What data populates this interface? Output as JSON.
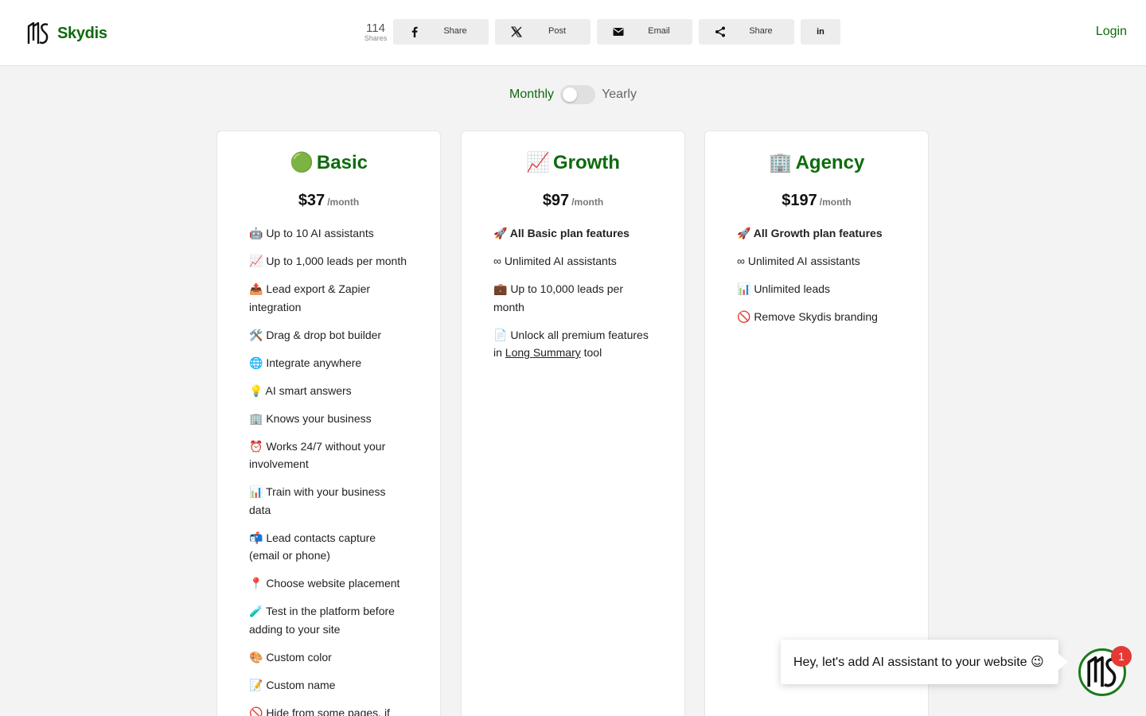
{
  "header": {
    "brand": "Skydis",
    "share_count": "114",
    "share_count_label": "Shares",
    "share_buttons": [
      {
        "label": "Share",
        "icon": "facebook-icon"
      },
      {
        "label": "Post",
        "icon": "x-icon"
      },
      {
        "label": "Email",
        "icon": "email-icon"
      },
      {
        "label": "Share",
        "icon": "share-icon"
      },
      {
        "label": "",
        "icon": "linkedin-icon"
      }
    ],
    "linkedin_glyph": "in",
    "login_label": "Login"
  },
  "billing_toggle": {
    "monthly_label": "Monthly",
    "yearly_label": "Yearly",
    "selected": "Monthly"
  },
  "plans": [
    {
      "emoji": "🟢",
      "name": "Basic",
      "price": "$37",
      "period": "/month",
      "features": [
        "🤖 Up to 10 AI assistants",
        "📈 Up to 1,000 leads per month",
        "📤 Lead export & Zapier integration",
        "🛠️ Drag & drop bot builder",
        "🌐 Integrate anywhere",
        "💡 AI smart answers",
        "🏢 Knows your business",
        "⏰ Works 24/7 without your involvement",
        "📊 Train with your business data",
        "📬 Lead contacts capture (email or phone)",
        "📍 Choose website placement",
        "🧪 Test in the platform before adding to your site",
        "🎨 Custom color",
        "📝 Custom name",
        "🚫 Hide from some pages, if"
      ]
    },
    {
      "emoji": "📈",
      "name": "Growth",
      "price": "$97",
      "period": "/month",
      "features": [
        "🚀 All Basic plan features",
        "∞ Unlimited AI assistants",
        "💼 Up to 10,000 leads per month"
      ],
      "last_feature": {
        "prefix": "📄 Unlock all premium features in ",
        "link": "Long Summary",
        "suffix": " tool"
      }
    },
    {
      "emoji": "🏢",
      "name": "Agency",
      "price": "$197",
      "period": "/month",
      "features": [
        "🚀 All Growth plan features",
        "∞ Unlimited AI assistants",
        "📊 Unlimited leads",
        "🚫 Remove Skydis branding"
      ]
    }
  ],
  "chat": {
    "message": "Hey, let's add AI assistant to your website 😉",
    "badge_count": "1"
  },
  "colors": {
    "brand_green": "#0e6b0e",
    "badge_red": "#e53935",
    "page_bg": "#f3f3f3"
  }
}
